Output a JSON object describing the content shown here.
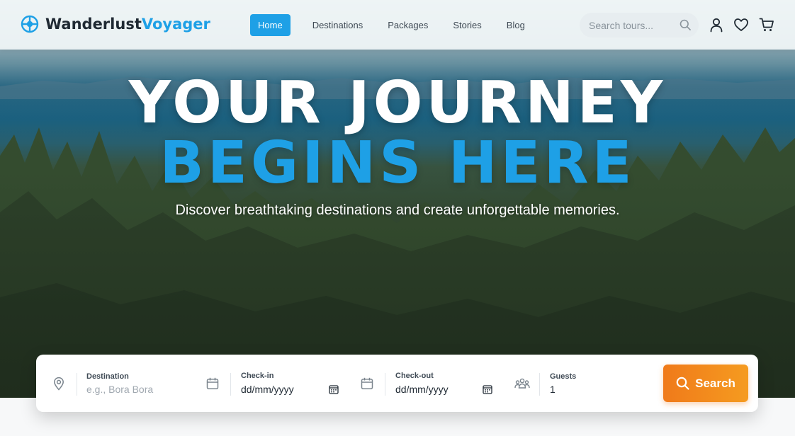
{
  "brand": {
    "name_part1": "Wanderlust",
    "name_part2": "Voyager",
    "logo_icon": "compass-crosshair-icon",
    "accent": "#1ea0e6"
  },
  "nav": {
    "items": [
      {
        "label": "Home",
        "active": true
      },
      {
        "label": "Destinations",
        "active": false
      },
      {
        "label": "Packages",
        "active": false
      },
      {
        "label": "Stories",
        "active": false
      },
      {
        "label": "Blog",
        "active": false
      }
    ]
  },
  "header_search": {
    "placeholder": "Search tours...",
    "icon": "search-icon"
  },
  "header_icons": [
    "user-icon",
    "heart-icon",
    "cart-icon"
  ],
  "hero": {
    "title_line1": "YOUR JOURNEY",
    "title_line2": "BEGINS HERE",
    "subtitle": "Discover breathtaking destinations and create unforgettable memories."
  },
  "booking": {
    "destination": {
      "label": "Destination",
      "placeholder": "e.g., Bora Bora",
      "icon": "location-pin-icon"
    },
    "checkin": {
      "label": "Check-in",
      "value": "dd/mm/yyyy",
      "icon": "calendar-icon"
    },
    "checkout": {
      "label": "Check-out",
      "value": "dd/mm/yyyy",
      "icon": "calendar-icon"
    },
    "guests": {
      "label": "Guests",
      "value": "1",
      "icon": "people-group-icon"
    },
    "search_label": "Search",
    "search_color": "#f07a1a"
  }
}
